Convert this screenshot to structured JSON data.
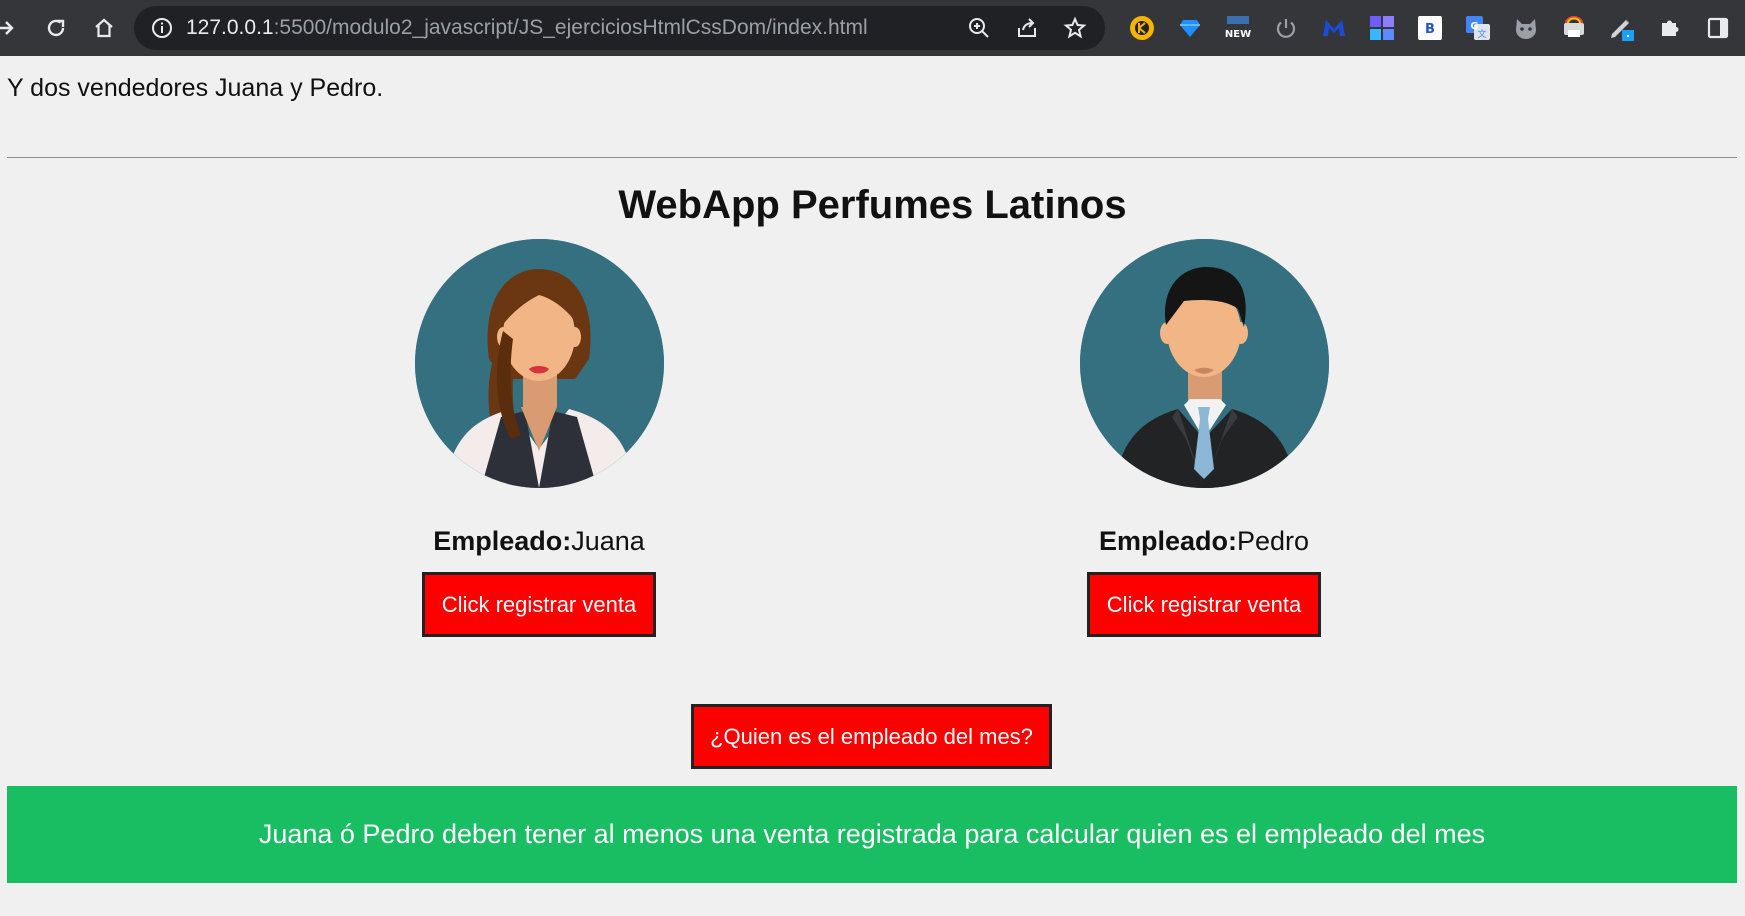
{
  "browser": {
    "url_host": "127.0.0.1",
    "url_path": ":5500/modulo2_javascript/JS_ejerciciosHtmlCssDom/index.html",
    "extensions": [
      "keepa-icon",
      "diamond-icon",
      "new-badge-icon",
      "power-icon",
      "malwarebytes-icon",
      "grid-app-icon",
      "b-extension-icon",
      "google-translate-icon",
      "cat-icon",
      "printer-rainbow-icon",
      "pen-edit-icon",
      "puzzle-icon",
      "sidepanel-icon"
    ]
  },
  "page": {
    "intro_text": "Y dos vendedores Juana y Pedro.",
    "title": "WebApp Perfumes Latinos",
    "employees": [
      {
        "label": "Empleado:",
        "name": "Juana",
        "button": "Click registrar venta"
      },
      {
        "label": "Empleado:",
        "name": "Pedro",
        "button": "Click registrar venta"
      }
    ],
    "month_button": "¿Quien es el empleado del mes?",
    "message": "Juana ó Pedro deben tener al menos una venta registrada para calcular quien es el empleado del mes"
  },
  "colors": {
    "accent_red": "#ff0000",
    "banner_green": "#19be63",
    "avatar_bg": "#34707f"
  }
}
